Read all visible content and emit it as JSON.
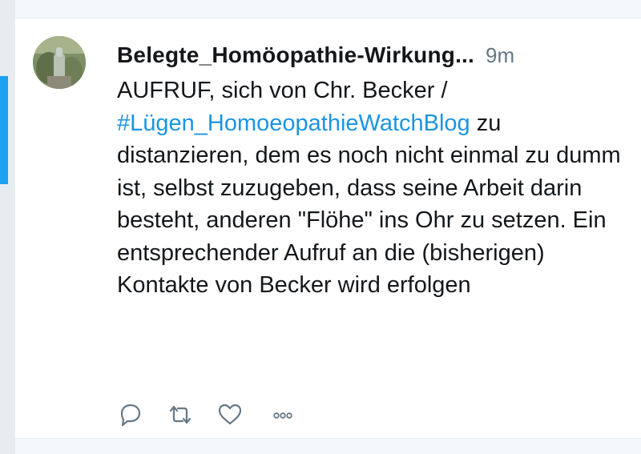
{
  "tweet": {
    "author_name": "Belegte_Homöopathie-Wirkung...",
    "timestamp": "9m",
    "text_part1": "AUFRUF, sich von Chr. Becker /",
    "hashtag": "#Lügen_HomoeopathieWatchBlog",
    "text_part2": " zu distanzieren, dem es noch nicht einmal zu dumm ist, selbst zuzugeben, dass seine Arbeit darin besteht, anderen \"Flöhe\" ins Ohr zu setzen. Ein entsprechender Aufruf an die (bisherigen) Kontakte von Becker wird erfolgen"
  },
  "actions": {
    "reply_icon": "reply-icon",
    "retweet_icon": "retweet-icon",
    "like_icon": "heart-icon",
    "more_icon": "more-icon"
  },
  "colors": {
    "accent": "#1da1f2",
    "link": "#1b95e0",
    "text": "#14171a",
    "muted": "#657786",
    "icon": "#657786",
    "background": "#e6ecf0"
  }
}
